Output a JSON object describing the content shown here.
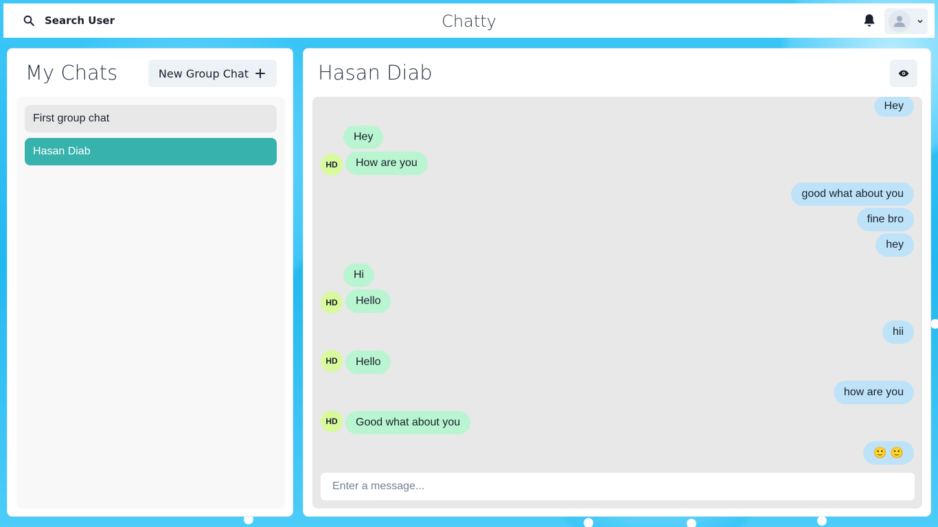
{
  "header": {
    "search_label": "Search User",
    "app_title": "Chatty"
  },
  "sidebar": {
    "title": "My Chats",
    "new_group_label": "New Group Chat",
    "chats": [
      {
        "label": "First group chat",
        "active": false
      },
      {
        "label": "Hasan Diab",
        "active": true
      }
    ]
  },
  "chat": {
    "title": "Hasan Diab",
    "avatar_initials": "HD",
    "messages": [
      {
        "text": "Hey",
        "from": "me"
      },
      {
        "text": "Hey",
        "from": "them"
      },
      {
        "text": "How are you",
        "from": "them"
      },
      {
        "text": "good what about you",
        "from": "me"
      },
      {
        "text": "fine bro",
        "from": "me"
      },
      {
        "text": "hey",
        "from": "me"
      },
      {
        "text": "Hi",
        "from": "them"
      },
      {
        "text": "Hello",
        "from": "them"
      },
      {
        "text": "hii",
        "from": "me"
      },
      {
        "text": "Hello",
        "from": "them"
      },
      {
        "text": "how are you",
        "from": "me"
      },
      {
        "text": "Good what about you",
        "from": "them"
      },
      {
        "text": "🙂 🙂",
        "from": "me"
      }
    ],
    "input_placeholder": "Enter a message..."
  },
  "colors": {
    "accent": "#38b2ac",
    "sent_bubble": "#bee3f8",
    "received_bubble": "#b9f5d0",
    "avatar_bg": "#d9f99d"
  }
}
